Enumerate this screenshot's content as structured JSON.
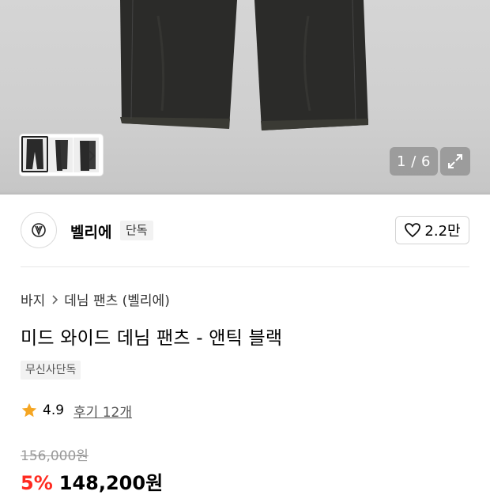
{
  "gallery": {
    "counter_text": "1 / 6",
    "thumbnail_count": 3,
    "icons": {
      "next": "chevron-right-icon",
      "expand": "expand-icon"
    }
  },
  "brand": {
    "name": "벨리에",
    "tag": "단독",
    "logo_icon": "brand-logo-icon"
  },
  "like": {
    "icon": "heart-outline-icon",
    "count": "2.2만"
  },
  "breadcrumb": {
    "items": [
      "바지",
      "데님 팬츠 (벨리에)"
    ],
    "separator_icon": "chevron-right-icon"
  },
  "product": {
    "title": "미드 와이드 데님 팬츠 - 앤틱 블랙",
    "exclusive_badge": "무신사단독"
  },
  "rating": {
    "icon": "star-icon",
    "star_color": "#f5a623",
    "value": "4.9",
    "review_link": "후기 12개"
  },
  "price": {
    "original": "156,000원",
    "discount": "5%",
    "sale": "148,200원",
    "discount_color": "#ff2a20"
  }
}
